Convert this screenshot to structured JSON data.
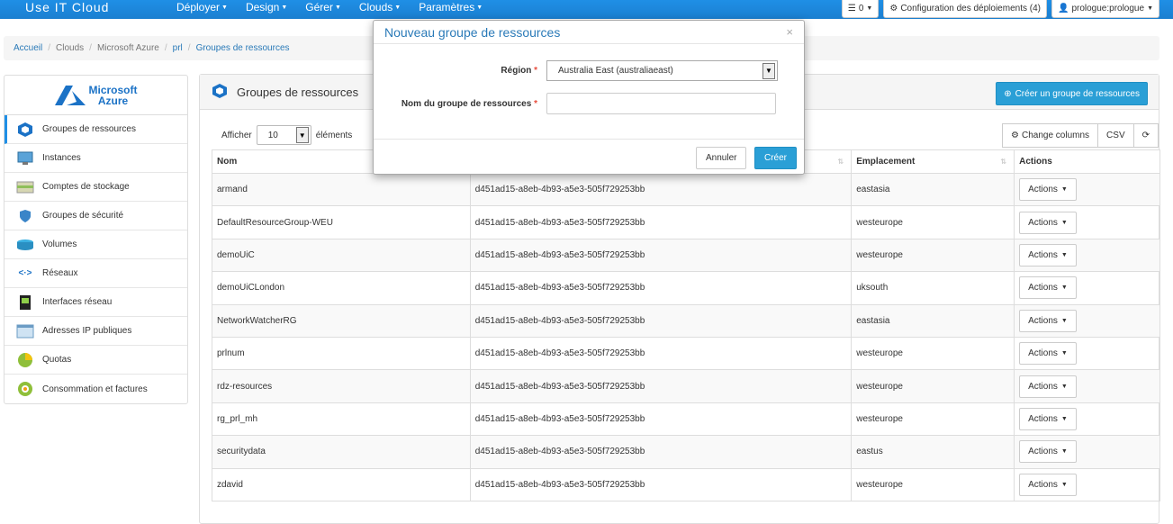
{
  "app": {
    "brand": "Use IT Cloud"
  },
  "nav": {
    "menu": [
      {
        "label": "Déployer"
      },
      {
        "label": "Design"
      },
      {
        "label": "Gérer"
      },
      {
        "label": "Clouds"
      },
      {
        "label": "Paramètres"
      }
    ],
    "notifications_count": "0",
    "deploy_config": "Configuration des déploiements (4)",
    "user": "prologue:prologue"
  },
  "breadcrumb": [
    "Accueil",
    "Clouds",
    "Microsoft Azure",
    "prl",
    "Groupes de ressources"
  ],
  "sidebar": {
    "logo_line1": "Microsoft",
    "logo_line2": "Azure",
    "items": [
      {
        "label": "Groupes de ressources",
        "icon": "cube-icon",
        "active": true
      },
      {
        "label": "Instances",
        "icon": "monitor-icon"
      },
      {
        "label": "Comptes de stockage",
        "icon": "storage-icon"
      },
      {
        "label": "Groupes de sécurité",
        "icon": "shield-icon"
      },
      {
        "label": "Volumes",
        "icon": "disk-icon"
      },
      {
        "label": "Réseaux",
        "icon": "network-icon"
      },
      {
        "label": "Interfaces réseau",
        "icon": "nic-icon"
      },
      {
        "label": "Adresses IP publiques",
        "icon": "public-ip-icon"
      },
      {
        "label": "Quotas",
        "icon": "pie-icon"
      },
      {
        "label": "Consommation et factures",
        "icon": "billing-icon"
      }
    ]
  },
  "panel": {
    "title": "Groupes de ressources",
    "create_label": "Créer un groupe de ressources",
    "show_prefix": "Afficher",
    "show_value": "10",
    "show_suffix": "éléments",
    "change_columns": "Change columns",
    "csv": "CSV"
  },
  "table": {
    "headers": [
      "Nom",
      "Emplacement",
      "Actions"
    ],
    "action_label": "Actions",
    "rows": [
      {
        "name": "armand",
        "id": "d451ad15-a8eb-4b93-a5e3-505f729253bb",
        "location": "eastasia"
      },
      {
        "name": "DefaultResourceGroup-WEU",
        "id": "d451ad15-a8eb-4b93-a5e3-505f729253bb",
        "location": "westeurope"
      },
      {
        "name": "demoUiC",
        "id": "d451ad15-a8eb-4b93-a5e3-505f729253bb",
        "location": "westeurope"
      },
      {
        "name": "demoUiCLondon",
        "id": "d451ad15-a8eb-4b93-a5e3-505f729253bb",
        "location": "uksouth"
      },
      {
        "name": "NetworkWatcherRG",
        "id": "d451ad15-a8eb-4b93-a5e3-505f729253bb",
        "location": "eastasia"
      },
      {
        "name": "prlnum",
        "id": "d451ad15-a8eb-4b93-a5e3-505f729253bb",
        "location": "westeurope"
      },
      {
        "name": "rdz-resources",
        "id": "d451ad15-a8eb-4b93-a5e3-505f729253bb",
        "location": "westeurope"
      },
      {
        "name": "rg_prl_mh",
        "id": "d451ad15-a8eb-4b93-a5e3-505f729253bb",
        "location": "westeurope"
      },
      {
        "name": "securitydata",
        "id": "d451ad15-a8eb-4b93-a5e3-505f729253bb",
        "location": "eastus"
      },
      {
        "name": "zdavid",
        "id": "d451ad15-a8eb-4b93-a5e3-505f729253bb",
        "location": "westeurope"
      }
    ]
  },
  "modal": {
    "title": "Nouveau groupe de ressources",
    "close": "×",
    "region_label": "Région",
    "required_mark": "*",
    "region_value": "Australia East (australiaeast)",
    "name_label": "Nom du groupe de ressources",
    "name_value": "",
    "name_placeholder": "",
    "cancel_label": "Annuler",
    "create_label": "Créer"
  },
  "colors": {
    "navbar": "#1f8fe6",
    "primary": "#2a9fd6",
    "link": "#2a7ab8",
    "azure": "#1b72c6",
    "required": "#e74c3c"
  }
}
